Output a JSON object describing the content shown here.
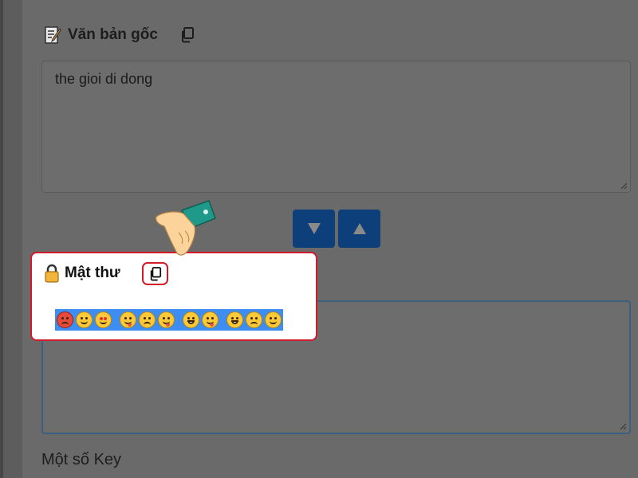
{
  "original_text": {
    "title": "Văn bản gốc",
    "value": "the gioi di dong"
  },
  "cipher": {
    "title": "Mật thư",
    "emoji_icons": [
      "angry-face-icon",
      "smiling-face-icon",
      "smiling-face-with-hearts-icon",
      "face-savoring-food-icon",
      "worried-face-icon",
      "face-savoring-food-icon",
      "grinning-face-icon",
      "face-savoring-food-icon",
      "grinning-face-with-sweat-icon",
      "worried-face-icon",
      "smiling-face-icon"
    ]
  },
  "keys": {
    "heading": "Một số Key"
  },
  "controls": {
    "down_icon": "triangle-down-icon",
    "up_icon": "triangle-up-icon"
  },
  "colors": {
    "button_blue": "#0d3f7a",
    "highlight_red": "#d11a2a",
    "selection_blue": "#3d8ef0"
  }
}
